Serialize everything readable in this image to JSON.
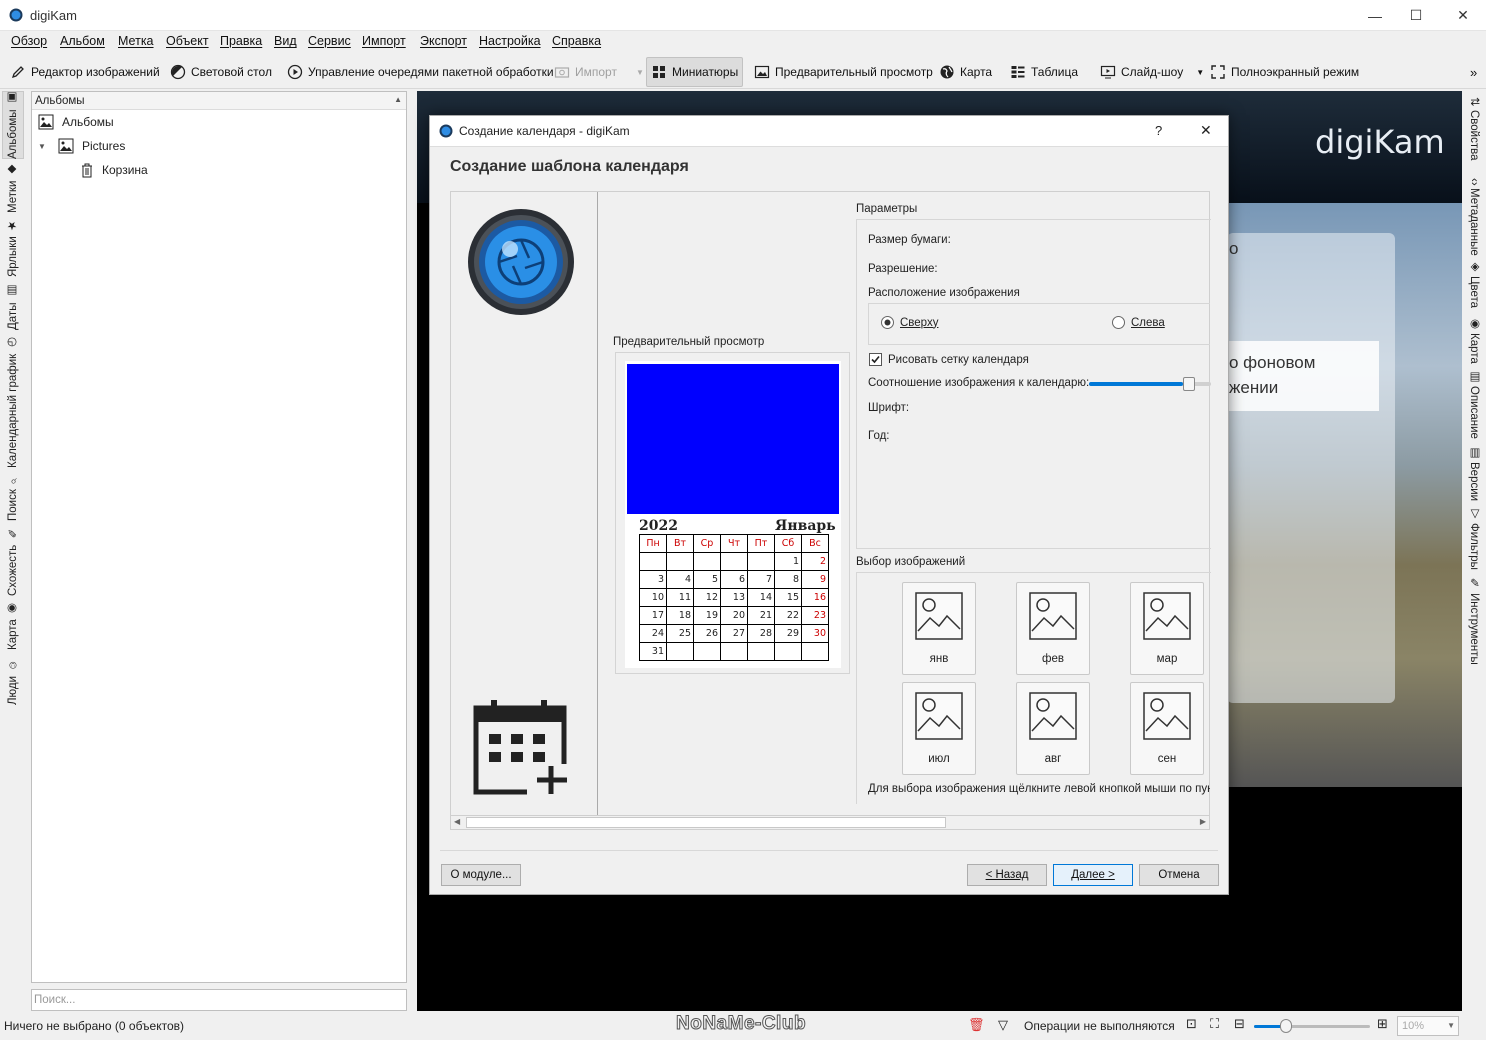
{
  "window": {
    "title": "digiKam",
    "minimize_label": "—",
    "maximize_label": "☐",
    "close_label": "✕"
  },
  "menu": [
    "Обзор",
    "Альбом",
    "Метка",
    "Объект",
    "Правка",
    "Вид",
    "Сервис",
    "Импорт",
    "Экспорт",
    "Настройка",
    "Справка"
  ],
  "toolbar": {
    "image_editor": "Редактор изображений",
    "light_table": "Световой стол",
    "batch_queue": "Управление очередями пакетной обработки",
    "import": "Импорт",
    "thumbnails": "Миниатюры",
    "preview": "Предварительный просмотр",
    "map": "Карта",
    "table": "Таблица",
    "slideshow": "Слайд-шоу",
    "fullscreen": "Полноэкранный режим",
    "more": "»"
  },
  "left_tabs": [
    "Альбомы",
    "Метки",
    "Ярлыки",
    "Даты",
    "Календарный график",
    "Поиск",
    "Схожесть",
    "Карта",
    "Люди"
  ],
  "right_tabs": [
    "Свойства",
    "Метаданные",
    "Цвета",
    "Карта",
    "Описание",
    "Версии",
    "Фильтры",
    "Инструменты"
  ],
  "albums": {
    "header": "Альбомы",
    "items": [
      {
        "label": "Альбомы"
      },
      {
        "label": "Pictures"
      },
      {
        "label": "Корзина"
      }
    ],
    "search_placeholder": "Поиск..."
  },
  "background": {
    "logo_text": "digiKam",
    "fragment_line1": "о фоновом",
    "fragment_line2": "жении",
    "fragment_o": "о"
  },
  "status": {
    "selection": "Ничего не выбрано (0 объектов)",
    "operations": "Операции не выполняются",
    "zoom": "10%",
    "watermark": "NoNaMe-Club",
    "zoom_slider_fraction": 0.28
  },
  "dialog": {
    "title": "Создание календаря - digiKam",
    "help": "?",
    "close": "✕",
    "heading": "Создание шаблона календаря",
    "preview_label": "Предварительный просмотр",
    "params": {
      "title": "Параметры",
      "paper_size": "Размер бумаги:",
      "resolution": "Разрешение:",
      "image_position": "Расположение изображения",
      "top": "Сверху",
      "left": "Слева",
      "draw_grid": "Рисовать сетку календаря",
      "ratio": "Соотношение изображения к календарю:",
      "ratio_fraction": 0.82,
      "font": "Шрифт:",
      "year": "Год:"
    },
    "images": {
      "title": "Выбор изображений",
      "months": [
        "янв",
        "фев",
        "мар",
        "июл",
        "авг",
        "сен"
      ],
      "hint": "Для выбора изображения щёлкните левой кнопкой мыши по пункт"
    },
    "calendar": {
      "year": "2022",
      "month": "Январь",
      "image_color": "#0000ff",
      "days": [
        "Пн",
        "Вт",
        "Ср",
        "Чт",
        "Пт",
        "Сб",
        "Вс"
      ],
      "weeks": [
        [
          "",
          "",
          "",
          "",
          "",
          "1",
          "2"
        ],
        [
          "3",
          "4",
          "5",
          "6",
          "7",
          "8",
          "9"
        ],
        [
          "10",
          "11",
          "12",
          "13",
          "14",
          "15",
          "16"
        ],
        [
          "17",
          "18",
          "19",
          "20",
          "21",
          "22",
          "23"
        ],
        [
          "24",
          "25",
          "26",
          "27",
          "28",
          "29",
          "30"
        ],
        [
          "31",
          "",
          "",
          "",
          "",
          "",
          ""
        ]
      ]
    },
    "buttons": {
      "about": "О модуле...",
      "back": "< Назад",
      "next": "Далее >",
      "cancel": "Отмена"
    },
    "scroll_fraction": 0.66
  }
}
